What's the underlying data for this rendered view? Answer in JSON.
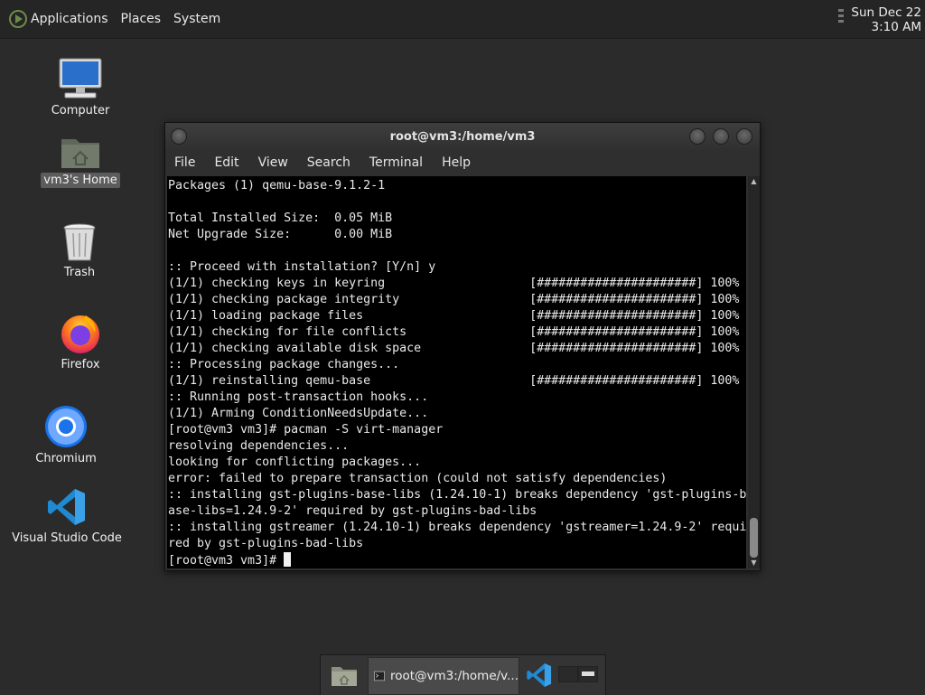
{
  "panel": {
    "menus": [
      "Applications",
      "Places",
      "System"
    ],
    "clock_date": "Sun Dec 22",
    "clock_time": "3:10 AM"
  },
  "desktop_icons": [
    {
      "label": "Computer",
      "icon": "computer-icon"
    },
    {
      "label": "vm3's Home",
      "icon": "home-folder-icon"
    },
    {
      "label": "Trash",
      "icon": "trash-icon"
    },
    {
      "label": "Firefox",
      "icon": "firefox-icon"
    },
    {
      "label": "Chromium",
      "icon": "chromium-icon"
    },
    {
      "label": "Visual Studio Code",
      "icon": "vscode-icon"
    }
  ],
  "window": {
    "title": "root@vm3:/home/vm3",
    "menu": [
      "File",
      "Edit",
      "View",
      "Search",
      "Terminal",
      "Help"
    ]
  },
  "terminal": {
    "lines": [
      "Packages (1) qemu-base-9.1.2-1",
      "",
      "Total Installed Size:  0.05 MiB",
      "Net Upgrade Size:      0.00 MiB",
      "",
      ":: Proceed with installation? [Y/n] y",
      "(1/1) checking keys in keyring                    [######################] 100%",
      "(1/1) checking package integrity                  [######################] 100%",
      "(1/1) loading package files                       [######################] 100%",
      "(1/1) checking for file conflicts                 [######################] 100%",
      "(1/1) checking available disk space               [######################] 100%",
      ":: Processing package changes...",
      "(1/1) reinstalling qemu-base                      [######################] 100%",
      ":: Running post-transaction hooks...",
      "(1/1) Arming ConditionNeedsUpdate...",
      "[root@vm3 vm3]# pacman -S virt-manager",
      "resolving dependencies...",
      "looking for conflicting packages...",
      "error: failed to prepare transaction (could not satisfy dependencies)",
      ":: installing gst-plugins-base-libs (1.24.10-1) breaks dependency 'gst-plugins-b",
      "ase-libs=1.24.9-2' required by gst-plugins-bad-libs",
      ":: installing gstreamer (1.24.10-1) breaks dependency 'gstreamer=1.24.9-2' requi",
      "red by gst-plugins-bad-libs"
    ],
    "prompt": "[root@vm3 vm3]# "
  },
  "taskbar": {
    "task_label": "root@vm3:/home/v..."
  }
}
